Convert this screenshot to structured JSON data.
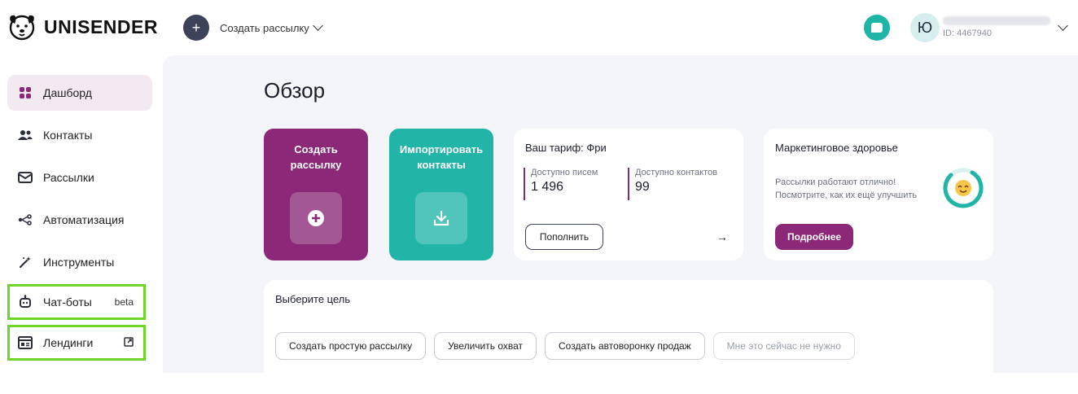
{
  "brand": {
    "name": "UNISENDER"
  },
  "header": {
    "create_label": "Создать рассылку",
    "account": {
      "avatar_letter": "Ю",
      "id_text": "ID: 4467940"
    }
  },
  "sidebar": {
    "items": [
      {
        "label": "Дашборд",
        "icon": "dashboard-icon",
        "active": true
      },
      {
        "label": "Контакты",
        "icon": "contacts-icon"
      },
      {
        "label": "Рассылки",
        "icon": "mail-icon"
      },
      {
        "label": "Автоматизация",
        "icon": "automation-icon"
      },
      {
        "label": "Инструменты",
        "icon": "magic-wand-icon"
      },
      {
        "label": "Чат-боты",
        "icon": "robot-icon",
        "badge": "beta"
      },
      {
        "label": "Лендинги",
        "icon": "landing-icon"
      }
    ]
  },
  "main": {
    "title": "Обзор",
    "tiles": {
      "create": {
        "label": "Создать рассылку",
        "color": "#8b2878"
      },
      "import": {
        "label": "Импортировать контакты",
        "color": "#21b5a8"
      }
    },
    "tariff": {
      "title": "Ваш тариф: Фри",
      "letters_label": "Доступно писем",
      "letters_value": "1 496",
      "contacts_label": "Доступно контактов",
      "contacts_value": "99",
      "refill_label": "Пополнить"
    },
    "health": {
      "title": "Маркетинговое здоровье",
      "text": "Рассылки работают отлично! Посмотрите, как их ещё улучшить",
      "button_label": "Подробнее"
    },
    "goal": {
      "title": "Выберите цель",
      "chips": [
        "Создать простую рассылку",
        "Увеличить охват",
        "Создать автоворонку продаж",
        "Мне это сейчас не нужно"
      ]
    }
  },
  "colors": {
    "accent": "#8b2878",
    "teal": "#21b5a8",
    "highlight": "#6ed628"
  }
}
